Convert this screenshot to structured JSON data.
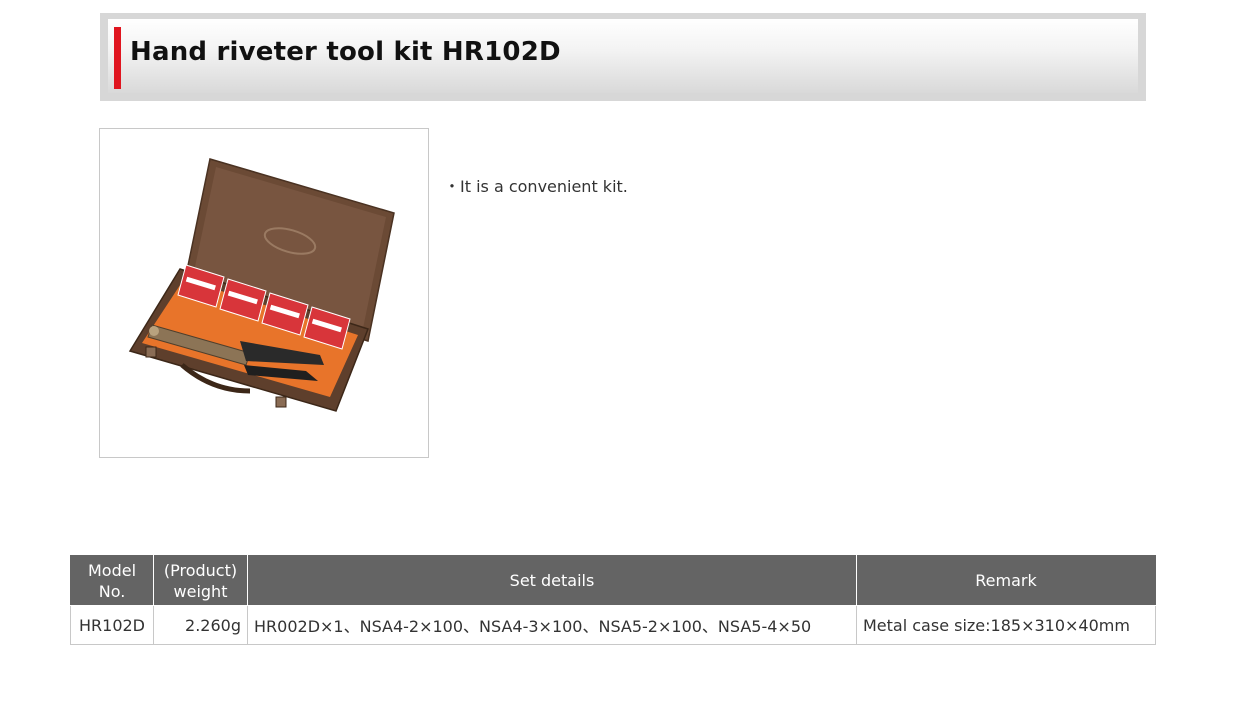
{
  "header": {
    "title": "Hand riveter tool kit HR102D",
    "accent_color": "#e0151f"
  },
  "product_image": {
    "icon": "rivet-tool-kit-image",
    "case_color": "#6b4a35",
    "lining_color": "#e8742a",
    "box_label_color": "#d8353a"
  },
  "description": {
    "text": "・It is a convenient kit."
  },
  "spec_table": {
    "header_bg": "#646464",
    "headers": {
      "model_line1": "Model",
      "model_line2": "No.",
      "weight_line1": "(Product)",
      "weight_line2": "weight",
      "set_details": "Set details",
      "remark": "Remark"
    },
    "rows": [
      {
        "model": "HR102D",
        "weight": "2.260g",
        "set_details": "HR002D×1、NSA4-2×100、NSA4-3×100、NSA5-2×100、NSA5-4×50",
        "remark": "Metal case size:185×310×40mm"
      }
    ]
  }
}
